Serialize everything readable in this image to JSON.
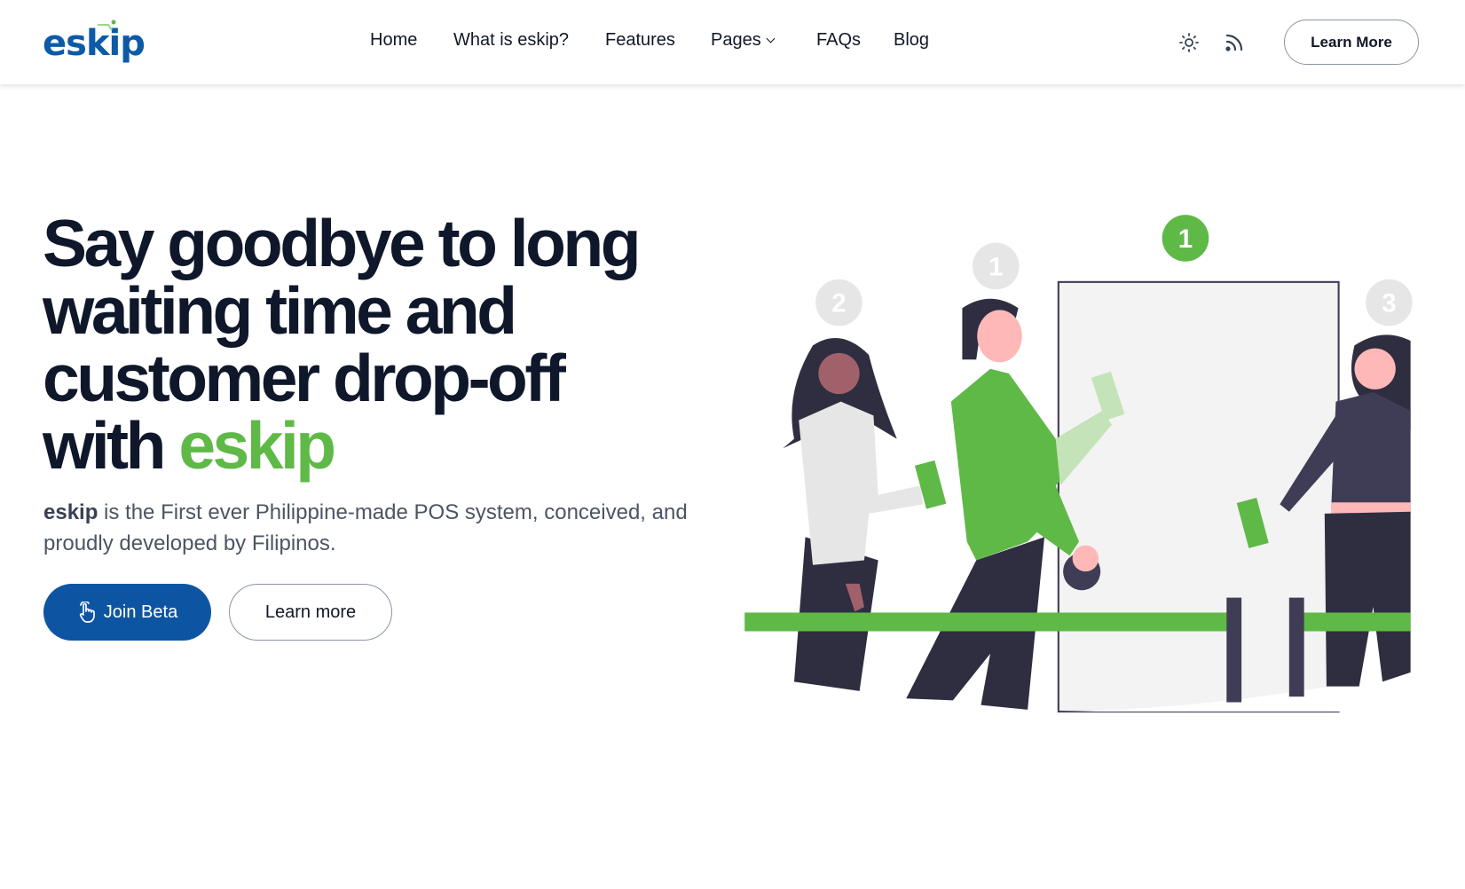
{
  "header": {
    "logo": "eskip",
    "nav": [
      {
        "label": "Home"
      },
      {
        "label": "What is eskip?"
      },
      {
        "label": "Features"
      },
      {
        "label": "Pages"
      },
      {
        "label": "FAQs"
      },
      {
        "label": "Blog"
      }
    ],
    "theme_icon": "sun-icon",
    "rss_icon": "rss-icon",
    "cta_label": "Learn More"
  },
  "hero": {
    "title_lines": [
      "Say goodbye to long",
      "waiting time and",
      "customer drop-off",
      "with "
    ],
    "title_accent": "eskip",
    "desc_brand": "eskip",
    "desc_rest": " is the First ever Philippine-made POS system, conceived, and proudly developed by Filipinos.",
    "primary_label": "Join Beta",
    "primary_icon": "hand-pointer-icon",
    "secondary_label": "Learn more",
    "queue_numbers": [
      "2",
      "1",
      "1",
      "3"
    ]
  },
  "colors": {
    "brand_blue": "#0d55a3",
    "brand_green": "#5fb946",
    "text_dark": "#0f172a"
  }
}
